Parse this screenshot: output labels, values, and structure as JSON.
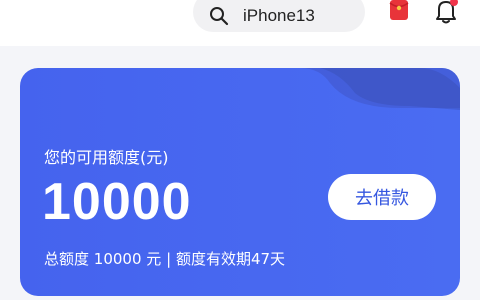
{
  "header": {
    "search": {
      "text": "iPhone13",
      "icon": "search-icon"
    },
    "red_packet": {
      "icon": "red-packet-icon",
      "color": "#e8343a"
    },
    "notifications": {
      "icon": "bell-icon",
      "badge_color": "#f0344a"
    }
  },
  "credit_card": {
    "label": "您的可用额度(元)",
    "amount": "10000",
    "borrow_button": "去借款",
    "total_prefix": "总额度",
    "total_amount": "10000",
    "total_unit": "元",
    "separator": "|",
    "validity_text": "额度有效期47天",
    "colors": {
      "card": "#4a6cf2",
      "accent": "#3657e0"
    }
  }
}
